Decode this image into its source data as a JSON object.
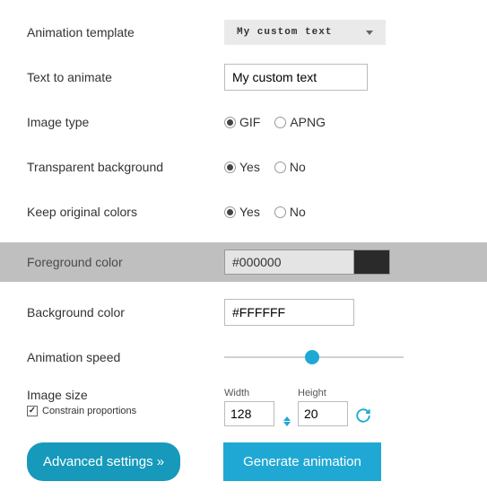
{
  "labels": {
    "template": "Animation template",
    "text_to_animate": "Text to animate",
    "image_type": "Image type",
    "transparent_bg": "Transparent background",
    "keep_colors": "Keep original colors",
    "foreground": "Foreground color",
    "background": "Background color",
    "speed": "Animation speed",
    "image_size": "Image size",
    "width": "Width",
    "height": "Height",
    "constrain": "Constrain proportions"
  },
  "template": {
    "display": "My custom text"
  },
  "text_value": "My custom text",
  "image_type": {
    "gif": "GIF",
    "apng": "APNG"
  },
  "yes": "Yes",
  "no": "No",
  "foreground_value": "#000000",
  "background_value": "#FFFFFF",
  "size": {
    "width": "128",
    "height": "20"
  },
  "buttons": {
    "advanced": "Advanced settings »",
    "generate": "Generate animation"
  }
}
